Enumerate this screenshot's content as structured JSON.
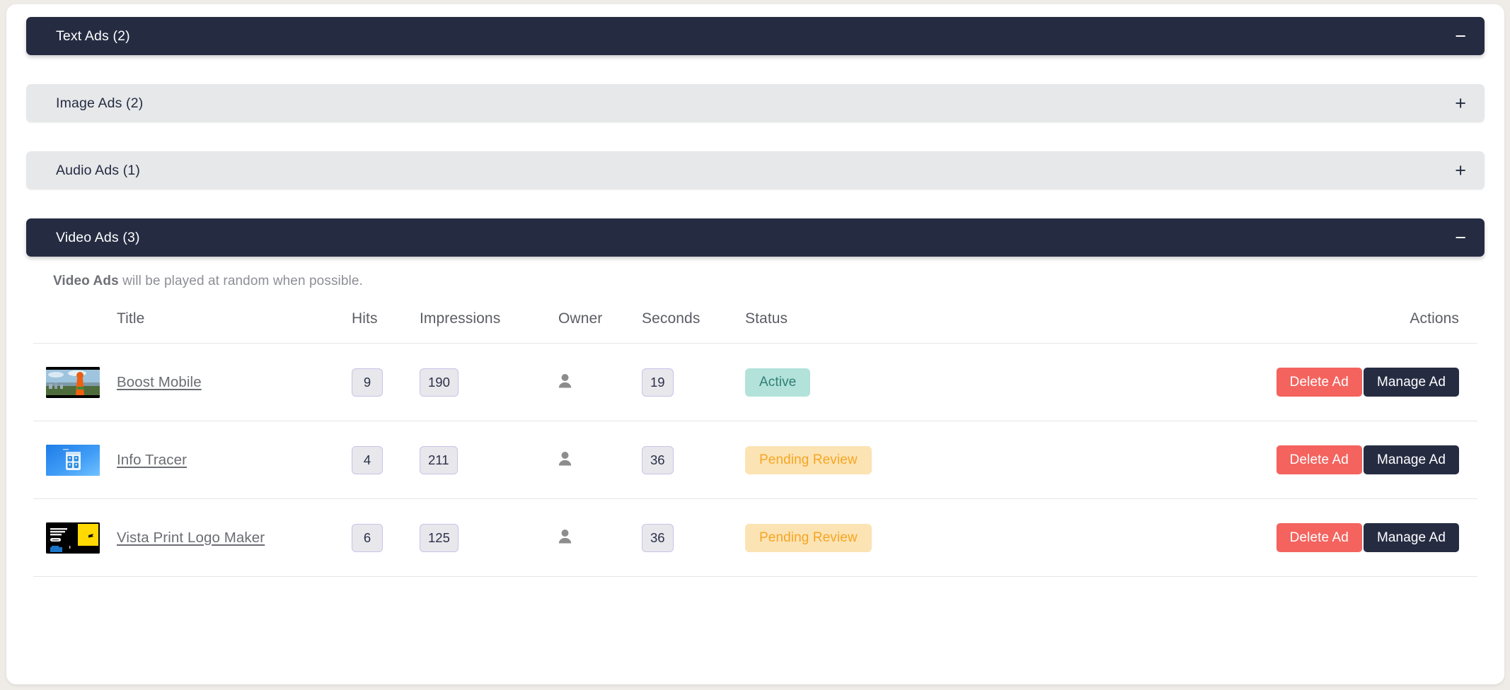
{
  "accordions": [
    {
      "label": "Text Ads (2)",
      "state": "open",
      "toggle_icon": "minus-icon",
      "toggle_glyph": "−"
    },
    {
      "label": "Image Ads (2)",
      "state": "closed",
      "toggle_icon": "plus-icon",
      "toggle_glyph": "+"
    },
    {
      "label": "Audio Ads (1)",
      "state": "closed",
      "toggle_icon": "plus-icon",
      "toggle_glyph": "+"
    },
    {
      "label": "Video Ads (3)",
      "state": "open",
      "toggle_icon": "minus-icon",
      "toggle_glyph": "−"
    }
  ],
  "panel": {
    "note_strong": "Video Ads",
    "note_rest": " will be played at random when possible.",
    "columns": {
      "thumb": "",
      "title": "Title",
      "hits": "Hits",
      "impressions": "Impressions",
      "owner": "Owner",
      "seconds": "Seconds",
      "status": "Status",
      "actions": "Actions"
    },
    "rows": [
      {
        "thumbnail": "boost-mobile-thumbnail",
        "title": "Boost Mobile",
        "hits": "9",
        "impressions": "190",
        "owner_icon": "person-icon",
        "seconds": "19",
        "status": "Active",
        "status_kind": "active",
        "delete_label": "Delete Ad",
        "manage_label": "Manage Ad"
      },
      {
        "thumbnail": "info-tracer-thumbnail",
        "title": "Info Tracer",
        "hits": "4",
        "impressions": "211",
        "owner_icon": "person-icon",
        "seconds": "36",
        "status": "Pending Review",
        "status_kind": "pending",
        "delete_label": "Delete Ad",
        "manage_label": "Manage Ad"
      },
      {
        "thumbnail": "vista-print-thumbnail",
        "title": "Vista Print Logo Maker",
        "hits": "6",
        "impressions": "125",
        "owner_icon": "person-icon",
        "seconds": "36",
        "status": "Pending Review",
        "status_kind": "pending",
        "delete_label": "Delete Ad",
        "manage_label": "Manage Ad"
      }
    ]
  },
  "colors": {
    "page_background": "#efece8",
    "card_background": "#ffffff",
    "accordion_open": "#252c42",
    "accordion_closed": "#e7e8ea",
    "delete_button": "#f4635e",
    "manage_button": "#252c42",
    "badge_active_bg": "#b2e2da",
    "badge_active_text": "#2f7f74",
    "badge_pending_bg": "#fce3b4",
    "badge_pending_text": "#f5a623",
    "pill_bg": "#e8e7ec",
    "pill_border": "#c9c2e8"
  }
}
